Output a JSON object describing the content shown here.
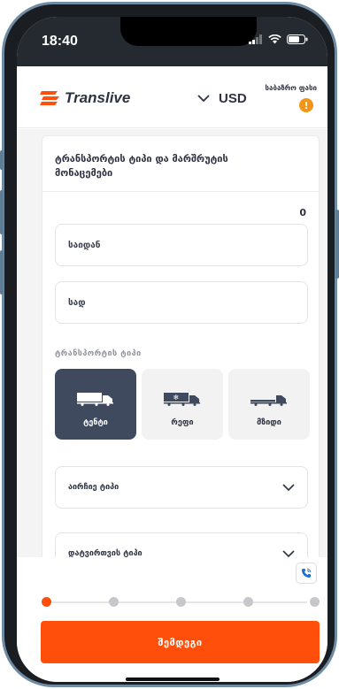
{
  "status_bar": {
    "time": "18:40"
  },
  "header": {
    "brand": "Translive",
    "currency": "USD",
    "price_label": "საბაზრო ფასი",
    "alert_badge": "!"
  },
  "form": {
    "title": "ტრანსპორტის ტიპი და მარშრუტის მონაცემები",
    "counter": "0",
    "from_field": "საიდან",
    "to_field": "სად",
    "transport_section_label": "ტრანსპორტის ტიპი",
    "transport_types": [
      {
        "label": "ტენტი",
        "selected": true
      },
      {
        "label": "რეფი",
        "selected": false
      },
      {
        "label": "მზიდი",
        "selected": false
      }
    ],
    "trailer_type_select": "აირჩიე ტიპი",
    "load_type_select": "დატვირთვის ტიპი"
  },
  "progress": {
    "total_steps": 5,
    "current_step": 1
  },
  "footer": {
    "next_button": "შემდეგი"
  },
  "colors": {
    "accent": "#ff4f0a",
    "selected_tile": "#404a5f",
    "badge": "#f39519"
  }
}
